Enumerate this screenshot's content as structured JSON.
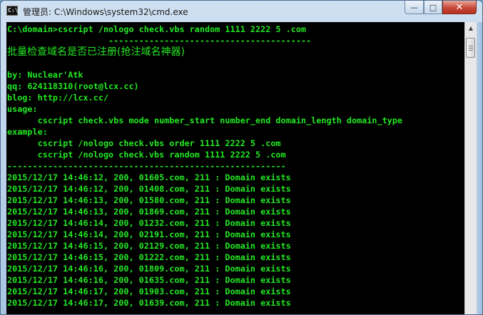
{
  "window": {
    "icon_label": "C:\\",
    "title": "管理员: C:\\Windows\\system32\\cmd.exe",
    "minimize_glyph": "—",
    "maximize_glyph": "□",
    "close_glyph": "✕"
  },
  "scrollbar": {
    "up_glyph": "▲"
  },
  "console": {
    "lines": [
      "C:\\domain>cscript /nologo check.vbs random 1111 2222 5 .com",
      "                    ----------------------------------------",
      "批量检查域名是否已注册(抢注域名神器)",
      "",
      "by: Nuclear'Atk",
      "qq: 624118310(root@lcx.cc)",
      "blog: http://lcx.cc/",
      "usage:",
      "      cscript check.vbs mode number_start number_end domain_length domain_type",
      "example:",
      "      cscript /nologo check.vbs order 1111 2222 5 .com",
      "      cscript /nologo check.vbs random 1111 2222 5 .com",
      "-------------------------------------------------------",
      "2015/12/17 14:46:12, 200, 01605.com, 211 : Domain exists",
      "2015/12/17 14:46:12, 200, 01408.com, 211 : Domain exists",
      "2015/12/17 14:46:13, 200, 01580.com, 211 : Domain exists",
      "2015/12/17 14:46:13, 200, 01869.com, 211 : Domain exists",
      "2015/12/17 14:46:14, 200, 01232.com, 211 : Domain exists",
      "2015/12/17 14:46:14, 200, 02191.com, 211 : Domain exists",
      "2015/12/17 14:46:15, 200, 02129.com, 211 : Domain exists",
      "2015/12/17 14:46:15, 200, 01222.com, 211 : Domain exists",
      "2015/12/17 14:46:16, 200, 01809.com, 211 : Domain exists",
      "2015/12/17 14:46:16, 200, 01635.com, 211 : Domain exists",
      "2015/12/17 14:46:17, 200, 01903.com, 211 : Domain exists",
      "2015/12/17 14:46:17, 200, 01639.com, 211 : Domain exists"
    ]
  },
  "colors": {
    "console_background": "#000000",
    "console_text": "#22e822",
    "close_button": "#c7483a"
  }
}
